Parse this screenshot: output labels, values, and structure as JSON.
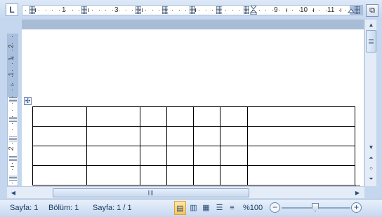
{
  "colors": {
    "ruler_margin": "#a9c0de",
    "status_bar_text": "#15365f",
    "workspace": "#a8bcd6"
  },
  "ruler": {
    "tab_selector_glyph": "L",
    "horizontal_numbers": [
      "1",
      "3",
      "9",
      "10",
      "11"
    ],
    "vertical_numbers": [
      "2",
      "1",
      "1",
      "2"
    ]
  },
  "icons": {
    "tab_selector": "tab-stop-left-icon",
    "view_ruler": "view-ruler-icon",
    "table_move": "move-cross-icon",
    "scroll_up": "triangle-up-icon",
    "scroll_down": "triangle-down-icon",
    "prev_page": "double-triangle-up-icon",
    "select_browse": "circle-icon",
    "next_page": "double-triangle-down-icon",
    "scroll_left": "triangle-left-icon",
    "scroll_right": "triangle-right-icon"
  },
  "glyphs": {
    "view_ruler": "⧉",
    "table_move": "✣",
    "scroll_up": "▲",
    "scroll_down": "▼",
    "prev_page": "⏶",
    "select_browse": "○",
    "next_page": "⏷",
    "scroll_left": "◀",
    "scroll_right": "▶",
    "view_print_layout": "▤",
    "view_full_screen": "▥",
    "view_web_layout": "▦",
    "view_outline": "☰",
    "view_draft": "≡",
    "zoom_out": "−",
    "zoom_in": "+"
  },
  "table": {
    "rows": 4,
    "columns": 7
  },
  "status_bar": {
    "page": "Sayfa: 1",
    "section": "Bölüm: 1",
    "page_of": "Sayfa: 1 / 1",
    "zoom": "%100",
    "active_view": "print-layout"
  },
  "zoom_slider": {
    "percent": 100
  }
}
